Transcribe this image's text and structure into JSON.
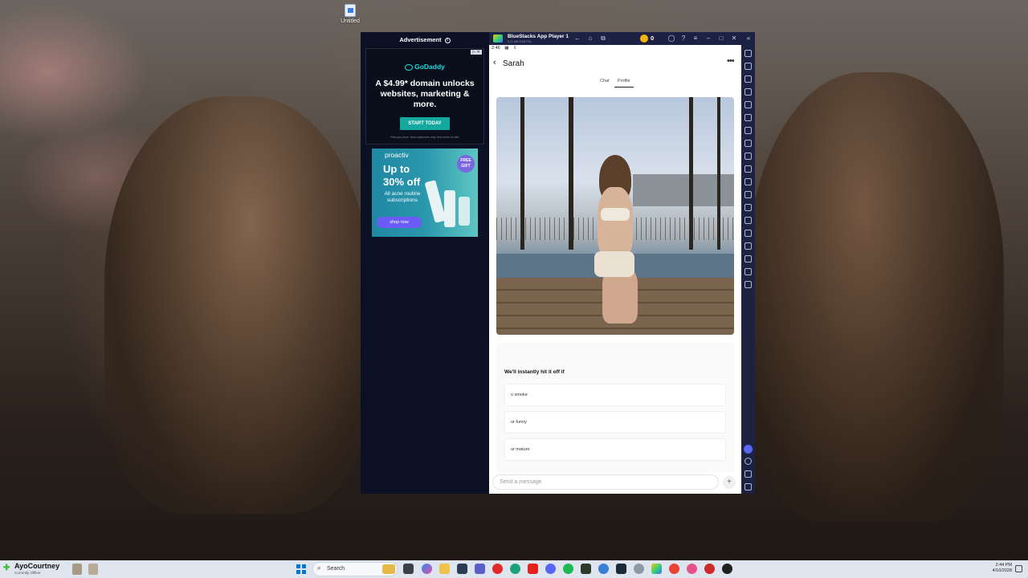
{
  "desktop": {
    "file_label": "Untitled"
  },
  "ad_panel": {
    "header": "Advertisement",
    "godaddy": {
      "brand": "GoDaddy",
      "headline": "A $4.99* domain unlocks websites, marketing & more.",
      "cta": "START TODAY",
      "fine_print": "*Not your price. New customers only. See terms on site."
    },
    "proactiv": {
      "brand": "proactiv",
      "headline_line1": "Up to",
      "headline_line2": "30% off",
      "subtext": "All acne routine subscriptions",
      "cta": "shop now",
      "badge": "FREE GIFT"
    }
  },
  "bluestacks": {
    "title": "BlueStacks App Player 1",
    "subtitle": "5.21.650.1063 P64",
    "coin_count": "0",
    "status_bar": {
      "time": "2:46"
    },
    "chat": {
      "contact_name": "Sarah",
      "tabs": [
        "Chat",
        "Profile"
      ],
      "active_tab": "Profile",
      "prompt_title": "We'll instantly hit it off if",
      "prompt_options": [
        "u smoke",
        "ur funny",
        "ur mature"
      ],
      "message_placeholder": "Send a message"
    }
  },
  "taskbar": {
    "user_name": "AyoCourtney",
    "user_sub": "Currently Offline",
    "search_placeholder": "Search",
    "clock_time": "2:44 PM",
    "clock_date": "4/10/2028"
  },
  "colors": {
    "bluestacks_frame": "#1a1f3a",
    "ad_background": "#0b1024",
    "godaddy_teal": "#14a89e",
    "proactiv_purple": "#6b5cf6",
    "discord_blurple": "#5865f2",
    "coin_gold": "#f2b50c"
  }
}
